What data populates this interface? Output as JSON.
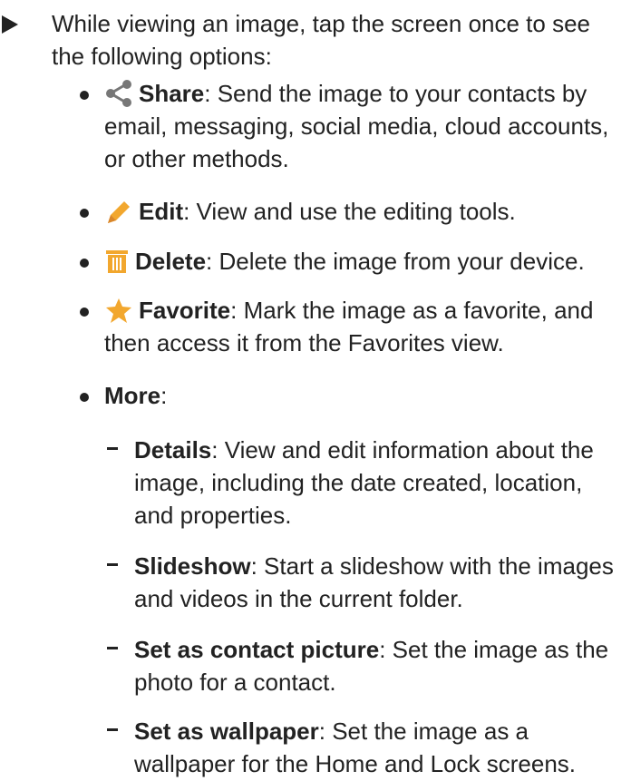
{
  "intro": "While viewing an image, tap the screen once to see the following options:",
  "options": {
    "share": {
      "icon": "share-icon",
      "title": "Share",
      "desc": ": Send the image to your contacts by email, messaging, social media, cloud accounts, or other methods."
    },
    "edit": {
      "icon": "pencil-icon",
      "title": "Edit",
      "desc": ": View and use the editing tools."
    },
    "delete": {
      "icon": "trash-icon",
      "title": "Delete",
      "desc": ": Delete the image from your device."
    },
    "favorite": {
      "icon": "star-icon",
      "title": "Favorite",
      "desc": ": Mark the image as a favorite, and then access it from the Favorites view."
    },
    "more": {
      "title": "More",
      "desc": ":"
    }
  },
  "more_items": {
    "details": {
      "title": "Details",
      "desc": ": View and edit information about the image, including the date created, location, and properties."
    },
    "slideshow": {
      "title": "Slideshow",
      "desc": ": Start a slideshow with the images and videos in the current folder."
    },
    "contact_picture": {
      "title": "Set as contact picture",
      "desc": ": Set the image as the photo for a contact."
    },
    "wallpaper": {
      "title": "Set as wallpaper",
      "desc": ": Set the image as a wallpaper for the Home and Lock screens."
    }
  },
  "colors": {
    "text": "#222222",
    "icon": "#f2a72e",
    "icon_gray": "#777777"
  }
}
